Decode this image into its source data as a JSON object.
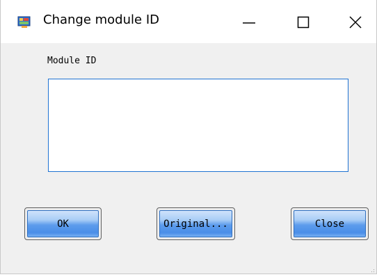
{
  "window": {
    "title": "Change module ID",
    "controls": {
      "minimize": "minimize-icon",
      "maximize": "maximize-icon",
      "close": "close-icon"
    }
  },
  "form": {
    "module_id_label": "Module ID",
    "module_id_value": ""
  },
  "buttons": {
    "ok_label": "OK",
    "original_label": "Original...",
    "close_label": "Close"
  },
  "colors": {
    "field_border": "#1e72d2",
    "button_gradient_mid": "#5d9cec",
    "window_background": "#f0f0f0"
  }
}
